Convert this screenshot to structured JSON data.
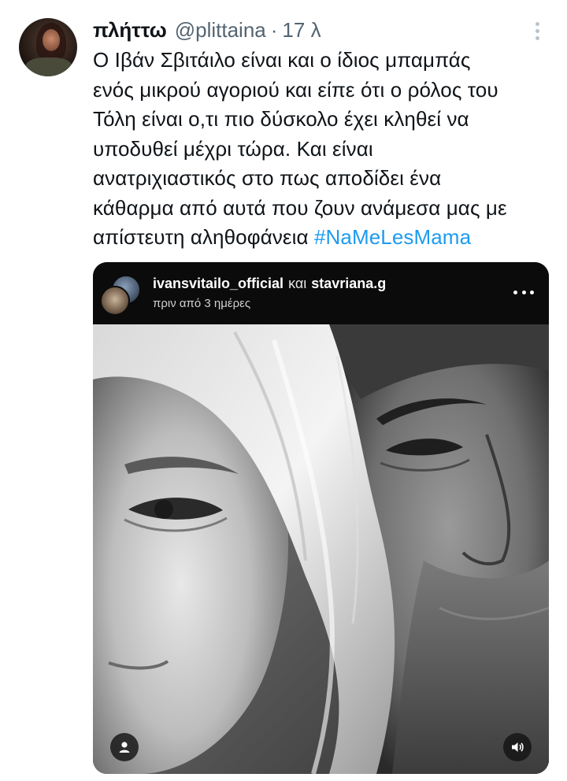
{
  "tweet": {
    "display_name": "πλήττω",
    "handle": "@plittaina",
    "separator": "·",
    "time": "17 λ",
    "text_lines": [
      "Ο Ιβάν Σβιτάιλο είναι και ο ίδιος μπαμπάς",
      "ενός μικρού αγοριού και είπε ότι ο ρόλος του",
      "Τόλη είναι ο,τι πιο δύσκολο έχει κληθεί να",
      "υποδυθεί μέχρι τώρα. Και είναι",
      "ανατριχιαστικός στο πως αποδίδει ένα",
      "κάθαρμα από αυτά που ζουν ανάμεσα μας με",
      "απίστευτη αληθοφάνεια "
    ],
    "hashtag": "#NaMeLesMama",
    "icons": {
      "more": "more-vertical-icon"
    },
    "colors": {
      "hashtag": "#1d9bf0",
      "secondary": "#536471"
    }
  },
  "embed": {
    "user1": "ivansvitailo_official",
    "conjunction": "και",
    "user2": "stavriana.g",
    "time": "πριν από 3 ημέρες",
    "icons": {
      "more": "more-horizontal-icon",
      "tag": "user-tag-icon",
      "audio": "speaker-icon"
    }
  }
}
